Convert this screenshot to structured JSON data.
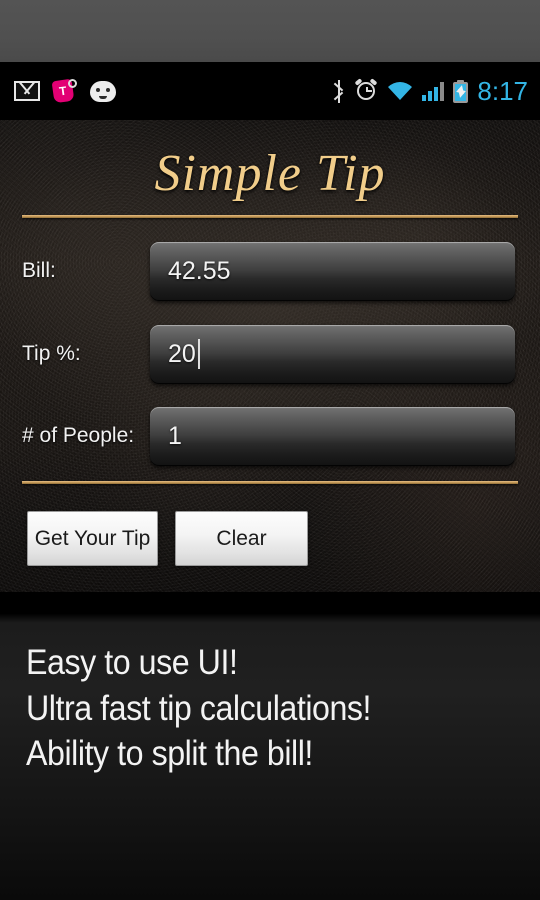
{
  "top_gutter": {
    "name": "page-background-band"
  },
  "status_bar": {
    "time": "8:17",
    "left_icons": [
      {
        "name": "gmail-icon",
        "label": "Gmail notification"
      },
      {
        "name": "tmobile-icon",
        "label": "T-Mobile"
      },
      {
        "name": "android-face-icon",
        "label": "Android system"
      }
    ],
    "right_icons": [
      {
        "name": "bluetooth-icon",
        "label": "Bluetooth"
      },
      {
        "name": "alarm-clock-icon",
        "label": "Alarm set"
      },
      {
        "name": "wifi-icon",
        "label": "Wi-Fi connected"
      },
      {
        "name": "signal-bars-icon",
        "label": "Cellular signal"
      },
      {
        "name": "battery-charging-icon",
        "label": "Battery charging"
      }
    ]
  },
  "app": {
    "title": "Simple Tip",
    "accent_gold": "#c79a57",
    "title_color": "#f1cd8a",
    "fields": [
      {
        "label": "Bill:",
        "value": "42.55",
        "placeholder": "",
        "focused": false
      },
      {
        "label": "Tip %:",
        "value": "20",
        "placeholder": "",
        "focused": true
      },
      {
        "label": "# of People:",
        "value": "1",
        "placeholder": "",
        "focused": false
      }
    ],
    "buttons": {
      "primary": "Get Your Tip",
      "secondary": "Clear"
    }
  },
  "description": {
    "lines": [
      "Easy to use UI!",
      "Ultra fast tip calculations!",
      "Ability to split the bill!"
    ]
  }
}
